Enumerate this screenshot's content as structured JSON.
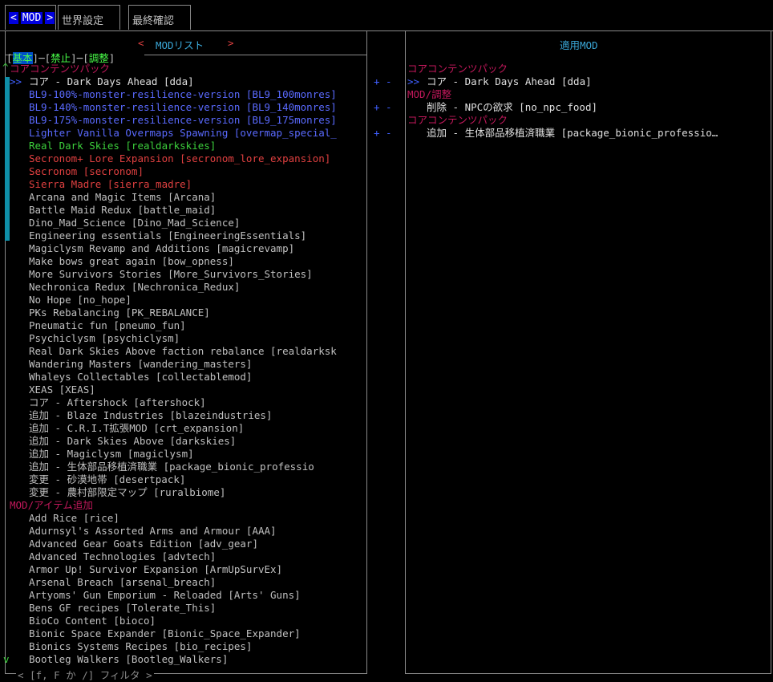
{
  "tabs": {
    "left_arrow": "<",
    "active": "MOD",
    "right_arrow": ">",
    "world": "世界設定",
    "final": "最終確認"
  },
  "left_panel": {
    "title_left": "<",
    "title": "MODリスト",
    "title_right": ">",
    "filters": [
      "基本",
      "禁止",
      "調整"
    ],
    "scroll_up": "^",
    "scroll_down": "v",
    "filter_hint": "< [f, F か /] フィルタ >",
    "sections": [
      {
        "name": "コアコンテンツパック",
        "items": [
          {
            "text": "コア - Dark Days Ahead [dda]",
            "color": "#e0e0e0",
            "selected": true
          },
          {
            "text": "BL9-100%-monster-resilience-version [BL9_100monres]",
            "color": "#5a6aff"
          },
          {
            "text": "BL9-140%-monster-resilience-version [BL9_140monres]",
            "color": "#5a6aff"
          },
          {
            "text": "BL9-175%-monster-resilience-version [BL9_175monres]",
            "color": "#5a6aff"
          },
          {
            "text": "Lighter Vanilla Overmaps Spawning [overmap_special_",
            "color": "#5a6aff"
          },
          {
            "text": "Real Dark Skies [realdarkskies]",
            "color": "#3ccf3c"
          },
          {
            "text": "Secronom+ Lore Expansion [secronom_lore_expansion]",
            "color": "#e04040"
          },
          {
            "text": "Secronom [secronom]",
            "color": "#e04040"
          },
          {
            "text": "Sierra Madre [sierra_madre]",
            "color": "#e04040"
          },
          {
            "text": "Arcana and Magic Items [Arcana]",
            "color": "#c0c0c0"
          },
          {
            "text": "Battle Maid Redux [battle_maid]",
            "color": "#c0c0c0"
          },
          {
            "text": "Dino_Mad_Science [Dino_Mad_Science]",
            "color": "#c0c0c0"
          },
          {
            "text": "Engineering essentials [EngineeringEssentials]",
            "color": "#c0c0c0"
          },
          {
            "text": "Magiclysm Revamp and Additions [magicrevamp]",
            "color": "#c0c0c0"
          },
          {
            "text": "Make bows great again [bow_opness]",
            "color": "#c0c0c0"
          },
          {
            "text": "More Survivors Stories [More_Survivors_Stories]",
            "color": "#c0c0c0"
          },
          {
            "text": "Nechronica Redux [Nechronica_Redux]",
            "color": "#c0c0c0"
          },
          {
            "text": "No Hope [no_hope]",
            "color": "#c0c0c0"
          },
          {
            "text": "PKs Rebalancing [PK_REBALANCE]",
            "color": "#c0c0c0"
          },
          {
            "text": "Pneumatic fun [pneumo_fun]",
            "color": "#c0c0c0"
          },
          {
            "text": "Psychiclysm [psychiclysm]",
            "color": "#c0c0c0"
          },
          {
            "text": "Real Dark Skies Above faction rebalance [realdarksk",
            "color": "#c0c0c0"
          },
          {
            "text": "Wandering Masters [wandering_masters]",
            "color": "#c0c0c0"
          },
          {
            "text": "Whaleys Collectables [collectablemod]",
            "color": "#c0c0c0"
          },
          {
            "text": "XEAS [XEAS]",
            "color": "#c0c0c0"
          },
          {
            "text": "コア - Aftershock [aftershock]",
            "color": "#c0c0c0"
          },
          {
            "text": "追加 - Blaze Industries [blazeindustries]",
            "color": "#c0c0c0"
          },
          {
            "text": "追加 - C.R.I.T拡張MOD [crt_expansion]",
            "color": "#c0c0c0"
          },
          {
            "text": "追加 - Dark Skies Above [darkskies]",
            "color": "#c0c0c0"
          },
          {
            "text": "追加 - Magiclysm [magiclysm]",
            "color": "#c0c0c0"
          },
          {
            "text": "追加 - 生体部品移植済職業 [package_bionic_professio",
            "color": "#c0c0c0"
          },
          {
            "text": "変更 - 砂漠地帯 [desertpack]",
            "color": "#c0c0c0"
          },
          {
            "text": "変更 - 農村部限定マップ [ruralbiome]",
            "color": "#c0c0c0"
          }
        ]
      },
      {
        "name": "MOD/アイテム追加",
        "items": [
          {
            "text": "Add Rice [rice]",
            "color": "#c0c0c0"
          },
          {
            "text": "Adurnsyl's Assorted Arms and Armour [AAA]",
            "color": "#c0c0c0"
          },
          {
            "text": "Advanced Gear Goats Edition [adv_gear]",
            "color": "#c0c0c0"
          },
          {
            "text": "Advanced Technologies [advtech]",
            "color": "#c0c0c0"
          },
          {
            "text": "Armor Up! Survivor Expansion [ArmUpSurvEx]",
            "color": "#c0c0c0"
          },
          {
            "text": "Arsenal Breach [arsenal_breach]",
            "color": "#c0c0c0"
          },
          {
            "text": "Artyoms' Gun Emporium - Reloaded [Arts' Guns]",
            "color": "#c0c0c0"
          },
          {
            "text": "Bens GF recipes [Tolerate_This]",
            "color": "#c0c0c0"
          },
          {
            "text": "BioCo Content [bioco]",
            "color": "#c0c0c0"
          },
          {
            "text": "Bionic Space Expander [Bionic_Space_Expander]",
            "color": "#c0c0c0"
          },
          {
            "text": "Bionics Systems Recipes [bio_recipes]",
            "color": "#c0c0c0"
          },
          {
            "text": "Bootleg Walkers [Bootleg_Walkers]",
            "color": "#c0c0c0"
          }
        ]
      }
    ]
  },
  "middle_panel": {
    "controls": [
      "+ -",
      "+ -",
      "+ -"
    ]
  },
  "right_panel": {
    "title": "適用MOD",
    "rows": [
      {
        "kind": "section",
        "text": "コアコンテンツパック"
      },
      {
        "kind": "item",
        "text": "コア - Dark Days Ahead [dda]",
        "selected": true
      },
      {
        "kind": "section",
        "text": "MOD/調整"
      },
      {
        "kind": "item",
        "text": "削除 - NPCの欲求 [no_npc_food]"
      },
      {
        "kind": "section",
        "text": "コアコンテンツパック"
      },
      {
        "kind": "item",
        "text": "追加 - 生体部品移植済職業 [package_bionic_professio…"
      }
    ],
    "cursor": ">>"
  }
}
